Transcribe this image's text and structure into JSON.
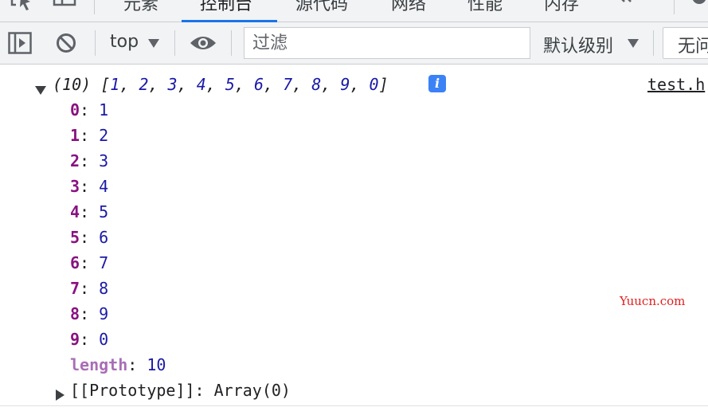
{
  "tabs": [
    {
      "label": "元素"
    },
    {
      "label": "控制台"
    },
    {
      "label": "源代码"
    },
    {
      "label": "网络"
    },
    {
      "label": "性能"
    },
    {
      "label": "内存"
    }
  ],
  "active_tab": "控制台",
  "toolbar": {
    "context": "top",
    "filter_placeholder": "过滤",
    "levels": "默认级别",
    "issues": "无问"
  },
  "console": {
    "summary": {
      "count": "(10)",
      "open_bracket": "[",
      "items": [
        "1",
        "2",
        "3",
        "4",
        "5",
        "6",
        "7",
        "8",
        "9",
        "0"
      ],
      "close_bracket": "]"
    },
    "source": "test.h",
    "entries": [
      {
        "key": "0",
        "value": "1"
      },
      {
        "key": "1",
        "value": "2"
      },
      {
        "key": "2",
        "value": "3"
      },
      {
        "key": "3",
        "value": "4"
      },
      {
        "key": "4",
        "value": "5"
      },
      {
        "key": "5",
        "value": "6"
      },
      {
        "key": "6",
        "value": "7"
      },
      {
        "key": "7",
        "value": "8"
      },
      {
        "key": "8",
        "value": "9"
      },
      {
        "key": "9",
        "value": "0"
      }
    ],
    "length": {
      "key": "length",
      "value": "10"
    },
    "prototype": {
      "key": "[[Prototype]]",
      "value": "Array(0)"
    }
  },
  "watermark": "Yuucn.com",
  "colors": {
    "accent": "#1a73e8",
    "key": "#881280",
    "number": "#1a1aa6",
    "info_badge": "#3b82f6",
    "watermark": "#e02020"
  }
}
